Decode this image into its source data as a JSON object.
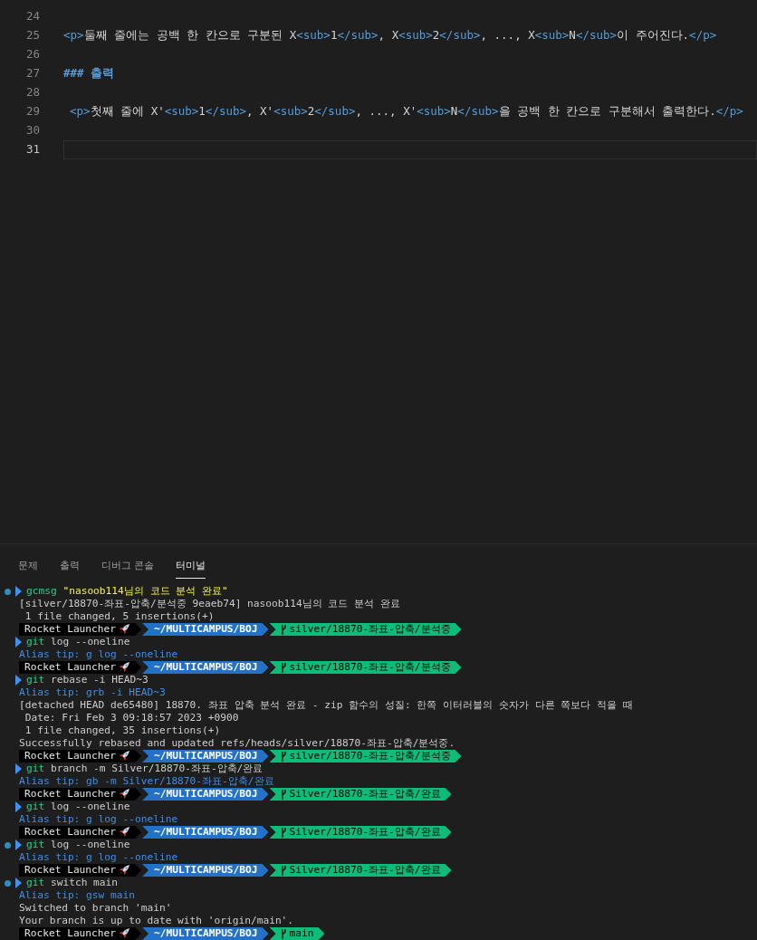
{
  "editor": {
    "lines": [
      {
        "number": "24",
        "current": false
      },
      {
        "number": "25",
        "current": false,
        "tokens": [
          {
            "kind": "tag",
            "text": "<p>"
          },
          {
            "kind": "text",
            "text": "둘째 줄에는 공백 한 칸으로 구분된 X"
          },
          {
            "kind": "tag",
            "text": "<sub>"
          },
          {
            "kind": "text",
            "text": "1"
          },
          {
            "kind": "tag",
            "text": "</sub>"
          },
          {
            "kind": "text",
            "text": ", X"
          },
          {
            "kind": "tag",
            "text": "<sub>"
          },
          {
            "kind": "text",
            "text": "2"
          },
          {
            "kind": "tag",
            "text": "</sub>"
          },
          {
            "kind": "text",
            "text": ", ..., X"
          },
          {
            "kind": "tag",
            "text": "<sub>"
          },
          {
            "kind": "text",
            "text": "N"
          },
          {
            "kind": "tag",
            "text": "</sub>"
          },
          {
            "kind": "text",
            "text": "이 주어진다."
          },
          {
            "kind": "tag",
            "text": "</p>"
          }
        ]
      },
      {
        "number": "26",
        "current": false
      },
      {
        "number": "27",
        "current": false,
        "tokens": [
          {
            "kind": "heading",
            "text": "### 출력"
          }
        ]
      },
      {
        "number": "28",
        "current": false
      },
      {
        "number": "29",
        "current": false,
        "indented": true,
        "tokens": [
          {
            "kind": "tag",
            "text": "<p>"
          },
          {
            "kind": "text",
            "text": "첫째 줄에 X'"
          },
          {
            "kind": "tag",
            "text": "<sub>"
          },
          {
            "kind": "text",
            "text": "1"
          },
          {
            "kind": "tag",
            "text": "</sub>"
          },
          {
            "kind": "text",
            "text": ", X'"
          },
          {
            "kind": "tag",
            "text": "<sub>"
          },
          {
            "kind": "text",
            "text": "2"
          },
          {
            "kind": "tag",
            "text": "</sub>"
          },
          {
            "kind": "text",
            "text": ", ..., X'"
          },
          {
            "kind": "tag",
            "text": "<sub>"
          },
          {
            "kind": "text",
            "text": "N"
          },
          {
            "kind": "tag",
            "text": "</sub>"
          },
          {
            "kind": "text",
            "text": "을 공백 한 칸으로 구분해서 출력한다."
          },
          {
            "kind": "tag",
            "text": "</p>"
          }
        ]
      },
      {
        "number": "30",
        "current": false
      },
      {
        "number": "31",
        "current": true
      }
    ]
  },
  "panel": {
    "tabs": [
      {
        "label": "문제",
        "selected": false
      },
      {
        "label": "출력",
        "selected": false
      },
      {
        "label": "디버그 콘솔",
        "selected": false
      },
      {
        "label": "터미널",
        "selected": true
      }
    ],
    "terminal": [
      {
        "kind": "command",
        "marked": true,
        "program": "gcmsg",
        "args": "\"nasoob114님의 코드 분석 완료\"",
        "quoted": true
      },
      {
        "kind": "output",
        "text": "[silver/18870-좌표-압축/분석중 9eaeb74] nasoob114님의 코드 분석 완료"
      },
      {
        "kind": "output",
        "text": " 1 file changed, 5 insertions(+)"
      },
      {
        "kind": "prompt",
        "user": "Rocket Launcher",
        "path": "~/MULTICAMPUS/BOJ",
        "branch": "silver/18870-좌표-압축/분석중"
      },
      {
        "kind": "command",
        "marked": false,
        "program": "git",
        "args": "log --oneline",
        "quoted": false
      },
      {
        "kind": "tip",
        "text": "Alias tip: g log --oneline"
      },
      {
        "kind": "prompt",
        "user": "Rocket Launcher",
        "path": "~/MULTICAMPUS/BOJ",
        "branch": "silver/18870-좌표-압축/분석중"
      },
      {
        "kind": "command",
        "marked": false,
        "program": "git",
        "args": "rebase -i HEAD~3",
        "quoted": false
      },
      {
        "kind": "tip",
        "text": "Alias tip: grb -i HEAD~3"
      },
      {
        "kind": "output",
        "text": "[detached HEAD de65480] 18870. 좌표 압축 분석 완료 - zip 함수의 성질: 한쪽 이터러블의 숫자가 다른 쪽보다 적을 때"
      },
      {
        "kind": "output",
        "text": " Date: Fri Feb 3 09:18:57 2023 +0900"
      },
      {
        "kind": "output",
        "text": " 1 file changed, 35 insertions(+)"
      },
      {
        "kind": "output",
        "text": "Successfully rebased and updated refs/heads/silver/18870-좌표-압축/분석중."
      },
      {
        "kind": "prompt",
        "user": "Rocket Launcher",
        "path": "~/MULTICAMPUS/BOJ",
        "branch": "silver/18870-좌표-압축/분석중"
      },
      {
        "kind": "command",
        "marked": false,
        "program": "git",
        "args": "branch -m Silver/18870-좌표-압축/완료",
        "quoted": false
      },
      {
        "kind": "tip",
        "text": "Alias tip: gb -m Silver/18870-좌표-압축/완료"
      },
      {
        "kind": "prompt",
        "user": "Rocket Launcher",
        "path": "~/MULTICAMPUS/BOJ",
        "branch": "Silver/18870-좌표-압축/완료"
      },
      {
        "kind": "command",
        "marked": false,
        "program": "git",
        "args": "log --oneline",
        "quoted": false
      },
      {
        "kind": "tip",
        "text": "Alias tip: g log --oneline"
      },
      {
        "kind": "prompt",
        "user": "Rocket Launcher",
        "path": "~/MULTICAMPUS/BOJ",
        "branch": "Silver/18870-좌표-압축/완료"
      },
      {
        "kind": "command",
        "marked": true,
        "program": "git",
        "args": "log --oneline",
        "quoted": false
      },
      {
        "kind": "tip",
        "text": "Alias tip: g log --oneline"
      },
      {
        "kind": "prompt",
        "user": "Rocket Launcher",
        "path": "~/MULTICAMPUS/BOJ",
        "branch": "Silver/18870-좌표-압축/완료"
      },
      {
        "kind": "command",
        "marked": true,
        "program": "git",
        "args": "switch main",
        "quoted": false
      },
      {
        "kind": "tip",
        "text": "Alias tip: gsw main"
      },
      {
        "kind": "output",
        "text": "Switched to branch 'main'"
      },
      {
        "kind": "output",
        "text": "Your branch is up to date with 'origin/main'."
      },
      {
        "kind": "prompt",
        "user": "Rocket Launcher",
        "path": "~/MULTICAMPUS/BOJ",
        "branch": "main"
      }
    ]
  }
}
